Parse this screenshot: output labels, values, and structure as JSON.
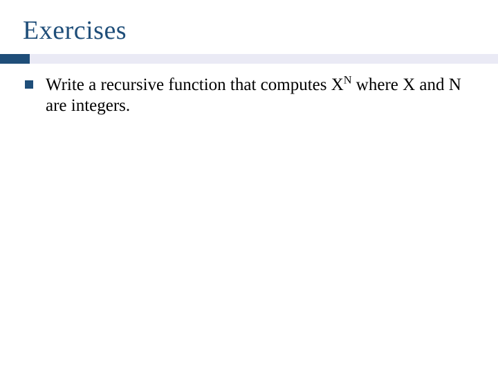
{
  "title": "Exercises",
  "bullet": {
    "prefix": "Write a recursive function that computes X",
    "superscript": "N",
    "suffix": " where X and N are integers."
  },
  "colors": {
    "heading": "#1f4e79",
    "accent_light": "#eaeaf5",
    "accent_dark": "#1f4e79"
  }
}
